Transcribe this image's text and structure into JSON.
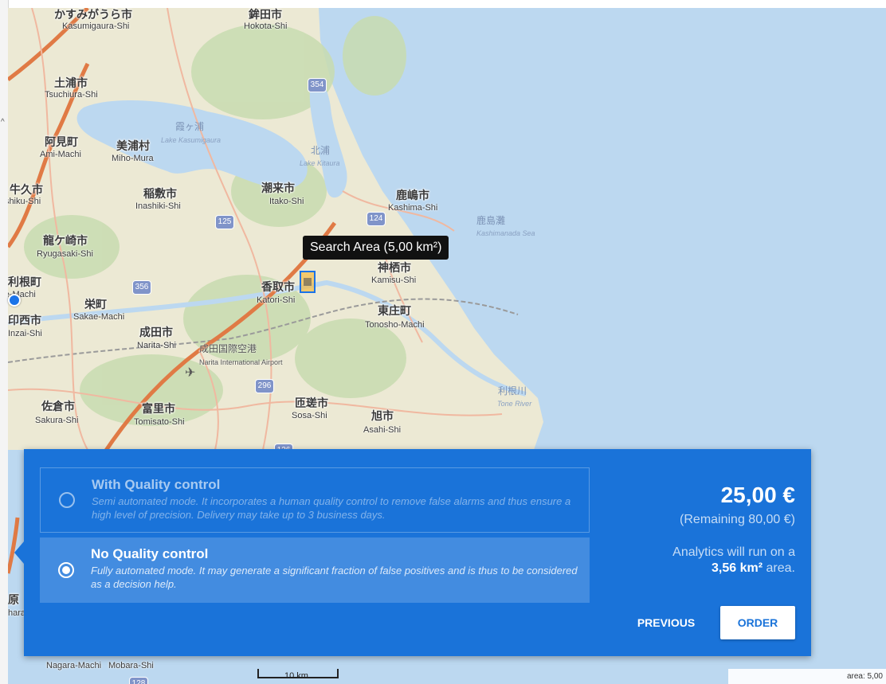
{
  "map": {
    "colors": {
      "water": "#bcd8f0",
      "land": "#ece9d4",
      "forest": "#c8dcb0",
      "road_major": "#e07a45",
      "road_minor": "#f0b8a0",
      "rail": "#9a9a9a"
    },
    "places": [
      {
        "jp": "かすみがうら市",
        "rom": "Kasumigaura-Shi"
      },
      {
        "jp": "鉾田市",
        "rom": "Hokota-Shi"
      },
      {
        "jp": "土浦市",
        "rom": "Tsuchiura-Shi"
      },
      {
        "jp": "阿見町",
        "rom": "Ami-Machi"
      },
      {
        "jp": "美浦村",
        "rom": "Miho-Mura"
      },
      {
        "jp": "牛久市",
        "rom": "Ushiku-Shi"
      },
      {
        "jp": "稲敷市",
        "rom": "Inashiki-Shi"
      },
      {
        "jp": "潮来市",
        "rom": "Itako-Shi"
      },
      {
        "jp": "鹿嶋市",
        "rom": "Kashima-Shi"
      },
      {
        "jp": "龍ケ崎市",
        "rom": "Ryugasaki-Shi"
      },
      {
        "jp": "神栖市",
        "rom": "Kamisu-Shi"
      },
      {
        "jp": "利根町",
        "rom": "Tone-Machi"
      },
      {
        "jp": "香取市",
        "rom": "Katori-Shi"
      },
      {
        "jp": "栄町",
        "rom": "Sakae-Machi"
      },
      {
        "jp": "印西市",
        "rom": "Inzai-Shi"
      },
      {
        "jp": "東庄町",
        "rom": "Tonosho-Machi"
      },
      {
        "jp": "成田市",
        "rom": "Narita-Shi"
      },
      {
        "jp": "佐倉市",
        "rom": "Sakura-Shi"
      },
      {
        "jp": "富里市",
        "rom": "Tomisato-Shi"
      },
      {
        "jp": "匝瑳市",
        "rom": "Sosa-Shi"
      },
      {
        "jp": "旭市",
        "rom": "Asahi-Shi"
      },
      {
        "jp": "原",
        "rom": "hara"
      }
    ],
    "bottom_labels": {
      "nagara": "Nagara-Machi",
      "mobara": "Mobara-Shi"
    },
    "water_labels": {
      "kasumigaura_jp": "霞ヶ浦",
      "kasumigaura_en": "Lake Kasumigaura",
      "kitaura_jp": "北浦",
      "kitaura_en": "Lake Kitaura",
      "kashimanada_jp": "鹿島灘",
      "kashimanada_en": "Kashimanada Sea",
      "tone_jp": "利根川",
      "tone_en": "Tone River"
    },
    "airport": {
      "jp": "成田国際空港",
      "en": "Narita International Airport"
    },
    "shields": [
      "354",
      "125",
      "124",
      "356",
      "296",
      "126",
      "128"
    ],
    "tooltip": "Search Area (5,00  km²)",
    "scale": "10 km",
    "area_readout": "area: 5,00"
  },
  "panel": {
    "options": [
      {
        "title": "With Quality control",
        "desc": "Semi automated mode. It incorporates a human quality control to remove false alarms and thus ensure a high level of precision. Delivery may take up to 3 business days.",
        "selected": false
      },
      {
        "title": "No Quality control",
        "desc": "Fully automated mode. It may generate a significant fraction of false positives and is thus to be considered as a decision help.",
        "selected": true
      }
    ],
    "price": "25,00 €",
    "remaining": "(Remaining 80,00 €)",
    "analytics_prefix": "Analytics will run on a",
    "analytics_area": "3,56  km²",
    "analytics_suffix": " area.",
    "previous_label": "PREVIOUS",
    "order_label": "ORDER",
    "accent": "#1a73d9"
  }
}
